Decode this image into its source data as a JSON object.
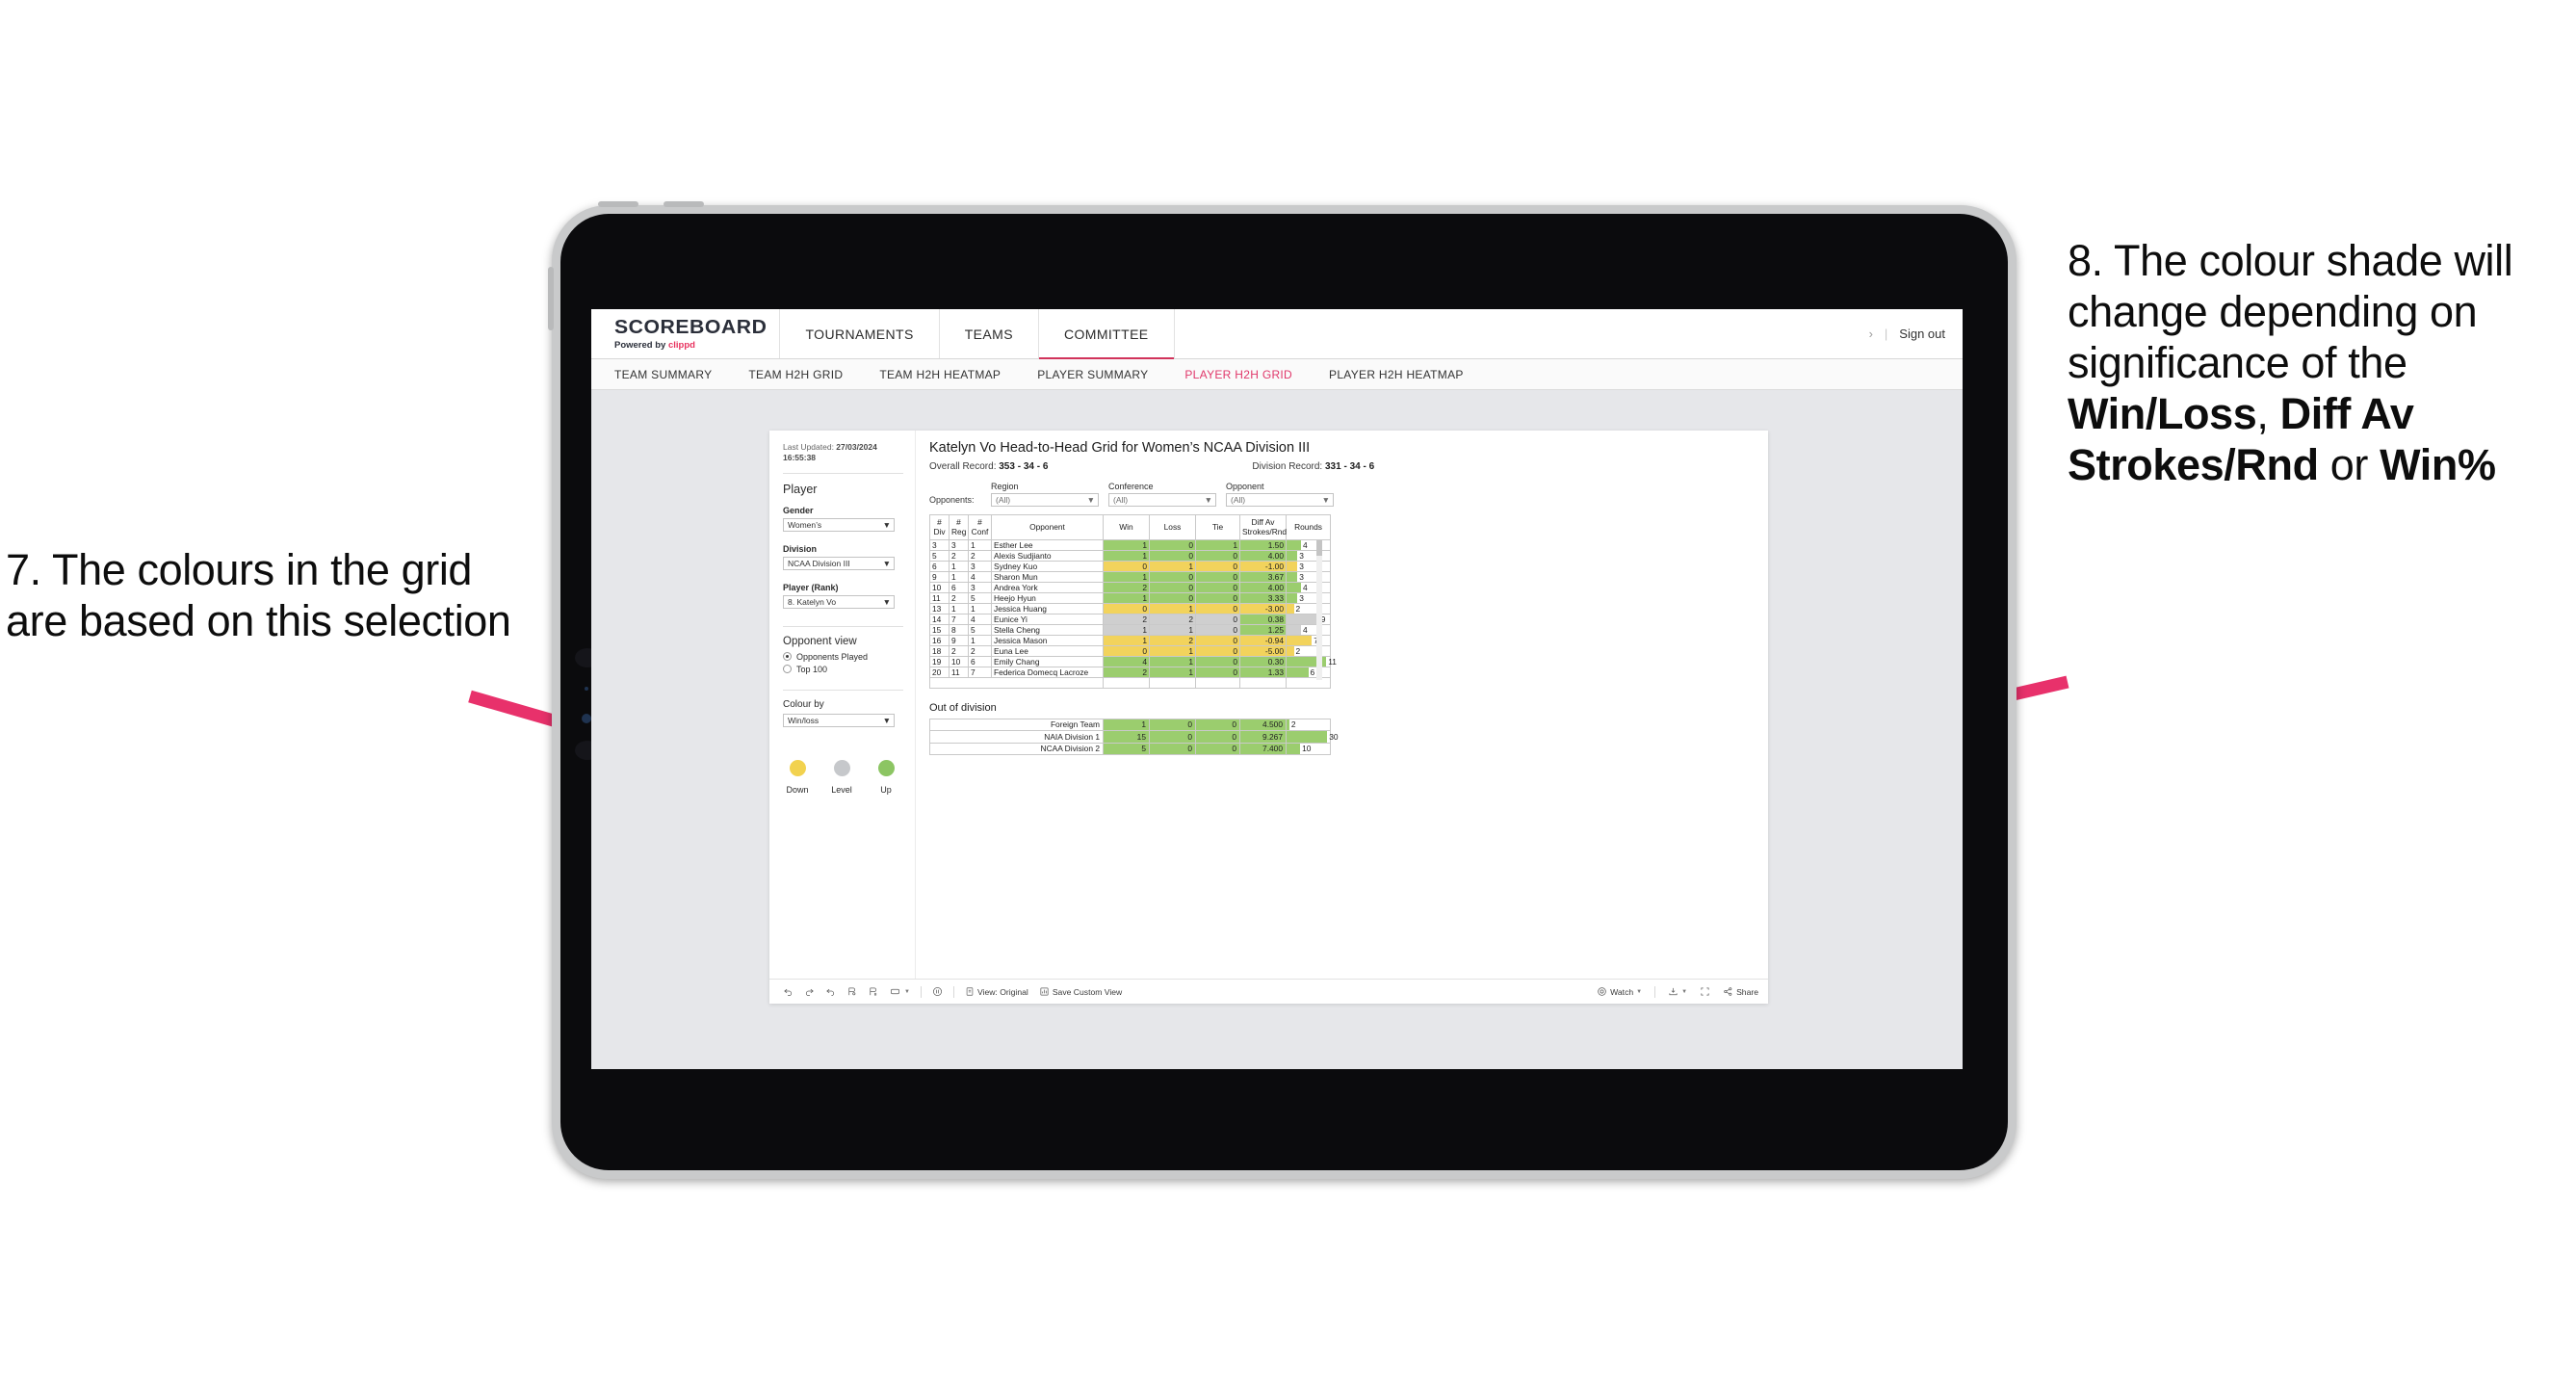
{
  "annotations": {
    "left": "7. The colours in the grid are based on this selection",
    "right_pre": "8. The colour shade will change depending on significance of the ",
    "right_b1": "Win/Loss",
    "right_mid1": ", ",
    "right_b2": "Diff Av Strokes/Rnd",
    "right_mid2": " or ",
    "right_b3": "Win%",
    "arrow_color": "#e8316b"
  },
  "appbar": {
    "brand_top": "SCOREBOARD",
    "brand_sub_pre": "Powered by ",
    "brand_sub_clippd": "clippd",
    "nav": [
      {
        "label": "TOURNAMENTS",
        "active": false
      },
      {
        "label": "TEAMS",
        "active": false
      },
      {
        "label": "COMMITTEE",
        "active": true
      }
    ],
    "chevron": "›",
    "divider": "|",
    "sign_out": "Sign out"
  },
  "subnav": [
    {
      "label": "TEAM SUMMARY",
      "active": false
    },
    {
      "label": "TEAM H2H GRID",
      "active": false
    },
    {
      "label": "TEAM H2H HEATMAP",
      "active": false
    },
    {
      "label": "PLAYER SUMMARY",
      "active": false
    },
    {
      "label": "PLAYER H2H GRID",
      "active": true
    },
    {
      "label": "PLAYER H2H HEATMAP",
      "active": false
    }
  ],
  "filters": {
    "last_updated_label": "Last Updated: ",
    "last_updated_value": "27/03/2024 16:55:38",
    "player_heading": "Player",
    "gender_label": "Gender",
    "gender_value": "Women’s",
    "division_label": "Division",
    "division_value": "NCAA Division III",
    "player_rank_label": "Player (Rank)",
    "player_rank_value": "8. Katelyn Vo",
    "opponent_view_label": "Opponent view",
    "opponent_view_options": [
      {
        "label": "Opponents Played",
        "selected": true
      },
      {
        "label": "Top 100",
        "selected": false
      }
    ],
    "colour_by_label": "Colour by",
    "colour_by_value": "Win/loss",
    "legend": [
      {
        "label": "Down",
        "color": "#f2d24f"
      },
      {
        "label": "Level",
        "color": "#c6c8cb"
      },
      {
        "label": "Up",
        "color": "#8cc563"
      }
    ]
  },
  "main": {
    "title": "Katelyn Vo Head-to-Head Grid for Women’s NCAA Division III",
    "overall_record_label": "Overall Record: ",
    "overall_record_value": "353 -  34 - 6",
    "division_record_label": "Division Record: ",
    "division_record_value": "331 -  34 - 6",
    "opponents_label": "Opponents:",
    "opponent_filters": [
      {
        "label": "Region",
        "value": "(All)"
      },
      {
        "label": "Conference",
        "value": "(All)"
      },
      {
        "label": "Opponent",
        "value": "(All)"
      }
    ],
    "out_of_division_title": "Out of division"
  },
  "chart_data": {
    "type": "table",
    "title": "Katelyn Vo Head-to-Head Grid for Women’s NCAA Division III",
    "columns": [
      "# Div",
      "# Reg",
      "# Conf",
      "Opponent",
      "Win",
      "Loss",
      "Tie",
      "Diff Av Strokes/Rnd",
      "Rounds"
    ],
    "header_lines": [
      [
        "#",
        "Div"
      ],
      [
        "#",
        "Reg"
      ],
      [
        "#",
        "Conf"
      ],
      [
        "Opponent",
        ""
      ],
      [
        "Win",
        ""
      ],
      [
        "Loss",
        ""
      ],
      [
        "Tie",
        ""
      ],
      [
        "Diff Av",
        "Strokes/Rnd"
      ],
      [
        "Rounds",
        ""
      ]
    ],
    "rounds_max": 12,
    "rows": [
      {
        "div": "3",
        "reg": "3",
        "conf": "1",
        "opponent": "Esther Lee",
        "win": "1",
        "loss": "0",
        "tie": "1",
        "diff": "1.50",
        "rounds": "4",
        "shade": "green"
      },
      {
        "div": "5",
        "reg": "2",
        "conf": "2",
        "opponent": "Alexis Sudjianto",
        "win": "1",
        "loss": "0",
        "tie": "0",
        "diff": "4.00",
        "rounds": "3",
        "shade": "green"
      },
      {
        "div": "6",
        "reg": "1",
        "conf": "3",
        "opponent": "Sydney Kuo",
        "win": "0",
        "loss": "1",
        "tie": "0",
        "diff": "-1.00",
        "rounds": "3",
        "shade": "yellow"
      },
      {
        "div": "9",
        "reg": "1",
        "conf": "4",
        "opponent": "Sharon Mun",
        "win": "1",
        "loss": "0",
        "tie": "0",
        "diff": "3.67",
        "rounds": "3",
        "shade": "green"
      },
      {
        "div": "10",
        "reg": "6",
        "conf": "3",
        "opponent": "Andrea York",
        "win": "2",
        "loss": "0",
        "tie": "0",
        "diff": "4.00",
        "rounds": "4",
        "shade": "green"
      },
      {
        "div": "11",
        "reg": "2",
        "conf": "5",
        "opponent": "Heejo Hyun",
        "win": "1",
        "loss": "0",
        "tie": "0",
        "diff": "3.33",
        "rounds": "3",
        "shade": "green"
      },
      {
        "div": "13",
        "reg": "1",
        "conf": "1",
        "opponent": "Jessica Huang",
        "win": "0",
        "loss": "1",
        "tie": "0",
        "diff": "-3.00",
        "rounds": "2",
        "shade": "yellow"
      },
      {
        "div": "14",
        "reg": "7",
        "conf": "4",
        "opponent": "Eunice Yi",
        "win": "2",
        "loss": "2",
        "tie": "0",
        "diff": "0.38",
        "rounds": "9",
        "shade": "grey",
        "diff_shade": "green"
      },
      {
        "div": "15",
        "reg": "8",
        "conf": "5",
        "opponent": "Stella Cheng",
        "win": "1",
        "loss": "1",
        "tie": "0",
        "diff": "1.25",
        "rounds": "4",
        "shade": "grey",
        "diff_shade": "green"
      },
      {
        "div": "16",
        "reg": "9",
        "conf": "1",
        "opponent": "Jessica Mason",
        "win": "1",
        "loss": "2",
        "tie": "0",
        "diff": "-0.94",
        "rounds": "7",
        "shade": "yellow"
      },
      {
        "div": "18",
        "reg": "2",
        "conf": "2",
        "opponent": "Euna Lee",
        "win": "0",
        "loss": "1",
        "tie": "0",
        "diff": "-5.00",
        "rounds": "2",
        "shade": "yellow"
      },
      {
        "div": "19",
        "reg": "10",
        "conf": "6",
        "opponent": "Emily Chang",
        "win": "4",
        "loss": "1",
        "tie": "0",
        "diff": "0.30",
        "rounds": "11",
        "shade": "green"
      },
      {
        "div": "20",
        "reg": "11",
        "conf": "7",
        "opponent": "Federica Domecq Lacroze",
        "win": "2",
        "loss": "1",
        "tie": "0",
        "diff": "1.33",
        "rounds": "6",
        "shade": "green"
      }
    ],
    "out_of_division": {
      "rounds_max": 32,
      "rows": [
        {
          "name": "Foreign Team",
          "win": "1",
          "loss": "0",
          "tie": "0",
          "diff": "4.500",
          "rounds": "2",
          "shade": "green"
        },
        {
          "name": "NAIA Division 1",
          "win": "15",
          "loss": "0",
          "tie": "0",
          "diff": "9.267",
          "rounds": "30",
          "shade": "green"
        },
        {
          "name": "NCAA Division 2",
          "win": "5",
          "loss": "0",
          "tie": "0",
          "diff": "7.400",
          "rounds": "10",
          "shade": "green"
        }
      ]
    }
  },
  "toolbar": {
    "view_original": "View: Original",
    "save_custom_view": "Save Custom View",
    "watch": "Watch",
    "share": "Share",
    "caret": "▾"
  }
}
